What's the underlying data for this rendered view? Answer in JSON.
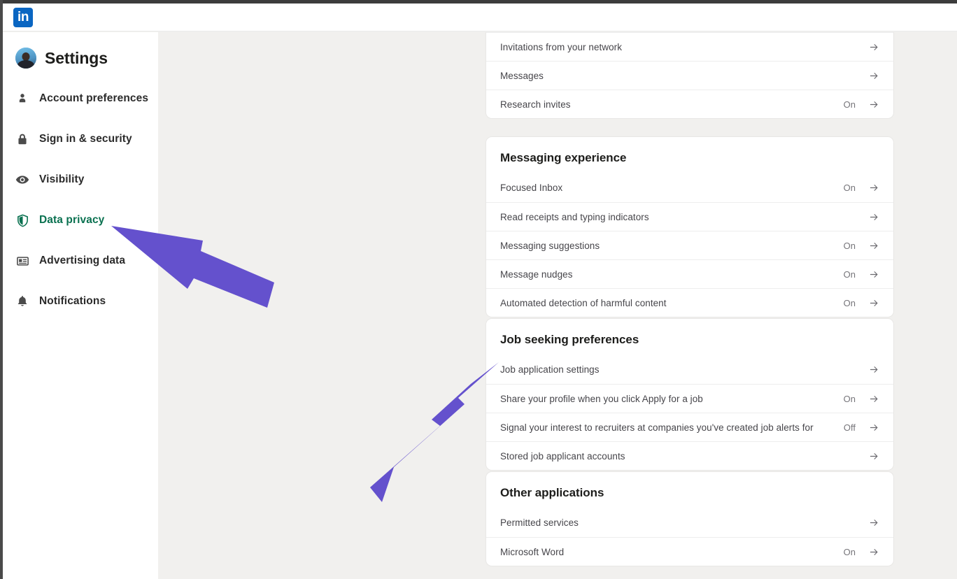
{
  "header": {
    "logo_text": "in",
    "logo_color": "#0a66c2"
  },
  "sidebar": {
    "title": "Settings",
    "active_color": "#0a7150",
    "items": [
      {
        "label": "Account preferences",
        "icon": "person-icon",
        "active": false
      },
      {
        "label": "Sign in & security",
        "icon": "lock-icon",
        "active": false
      },
      {
        "label": "Visibility",
        "icon": "eye-icon",
        "active": false
      },
      {
        "label": "Data privacy",
        "icon": "shield-icon",
        "active": true
      },
      {
        "label": "Advertising data",
        "icon": "ad-card-icon",
        "active": false
      },
      {
        "label": "Notifications",
        "icon": "bell-icon",
        "active": false
      }
    ]
  },
  "main": {
    "cards": [
      {
        "heading": "",
        "clipped": true,
        "rows": [
          {
            "label": "Invitations from your network",
            "value": ""
          },
          {
            "label": "Messages",
            "value": ""
          },
          {
            "label": "Research invites",
            "value": "On"
          }
        ]
      },
      {
        "heading": "Messaging experience",
        "clipped": false,
        "rows": [
          {
            "label": "Focused Inbox",
            "value": "On"
          },
          {
            "label": "Read receipts and typing indicators",
            "value": ""
          },
          {
            "label": "Messaging suggestions",
            "value": "On"
          },
          {
            "label": "Message nudges",
            "value": "On"
          },
          {
            "label": "Automated detection of harmful content",
            "value": "On"
          }
        ]
      },
      {
        "heading": "Job seeking preferences",
        "clipped": false,
        "rows": [
          {
            "label": "Job application settings",
            "value": ""
          },
          {
            "label": "Share your profile when you click Apply for a job",
            "value": "On"
          },
          {
            "label": "Signal your interest to recruiters at companies you've created job alerts for",
            "value": "Off"
          },
          {
            "label": "Stored job applicant accounts",
            "value": ""
          }
        ]
      },
      {
        "heading": "Other applications",
        "clipped": false,
        "rows": [
          {
            "label": "Permitted services",
            "value": ""
          },
          {
            "label": "Microsoft Word",
            "value": "On"
          }
        ]
      }
    ]
  },
  "annotations": {
    "color": "#6451cd",
    "arrows": [
      {
        "name": "arrow-pointing-to-data-privacy",
        "target": "Data privacy"
      },
      {
        "name": "arrow-pointing-to-job-application-settings",
        "target": "Job application settings"
      }
    ]
  }
}
